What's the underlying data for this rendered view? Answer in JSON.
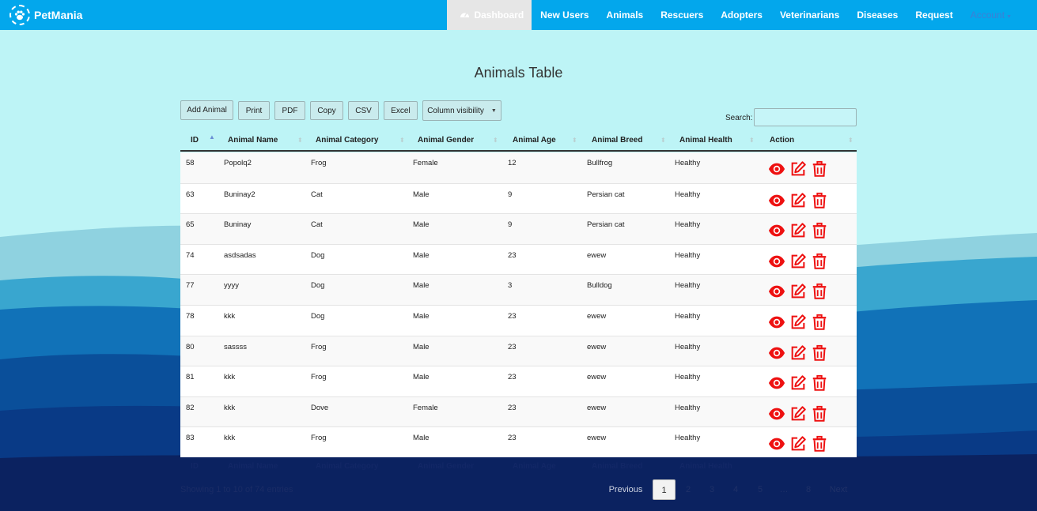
{
  "navbar": {
    "brand": "PetMania",
    "items": [
      {
        "label": "Dashboard"
      },
      {
        "label": "New Users"
      },
      {
        "label": "Animals"
      },
      {
        "label": "Rescuers"
      },
      {
        "label": "Adopters"
      },
      {
        "label": "Veterinarians"
      },
      {
        "label": "Diseases"
      },
      {
        "label": "Request"
      },
      {
        "label": "Account"
      }
    ]
  },
  "page": {
    "title": "Animals Table"
  },
  "toolbar": {
    "add": "Add Animal",
    "print": "Print",
    "pdf": "PDF",
    "copy": "Copy",
    "csv": "CSV",
    "excel": "Excel",
    "colvis": "Column visibility",
    "search_label": "Search:",
    "search_value": ""
  },
  "table": {
    "columns": [
      "ID",
      "Animal Name",
      "Animal Category",
      "Animal Gender",
      "Animal Age",
      "Animal Breed",
      "Animal Health",
      "Action"
    ],
    "rows": [
      [
        "58",
        "Popolq2",
        "Frog",
        "Female",
        "12",
        "Bullfrog",
        "Healthy"
      ],
      [
        "63",
        "Buninay2",
        "Cat",
        "Male",
        "9",
        "Persian cat",
        "Healthy"
      ],
      [
        "65",
        "Buninay",
        "Cat",
        "Male",
        "9",
        "Persian cat",
        "Healthy"
      ],
      [
        "74",
        "asdsadas",
        "Dog",
        "Male",
        "23",
        "ewew",
        "Healthy"
      ],
      [
        "77",
        "yyyy",
        "Dog",
        "Male",
        "3",
        "Bulldog",
        "Healthy"
      ],
      [
        "78",
        "kkk",
        "Dog",
        "Male",
        "23",
        "ewew",
        "Healthy"
      ],
      [
        "80",
        "sassss",
        "Frog",
        "Male",
        "23",
        "ewew",
        "Healthy"
      ],
      [
        "81",
        "kkk",
        "Frog",
        "Male",
        "23",
        "ewew",
        "Healthy"
      ],
      [
        "82",
        "kkk",
        "Dove",
        "Female",
        "23",
        "ewew",
        "Healthy"
      ],
      [
        "83",
        "kkk",
        "Frog",
        "Male",
        "23",
        "ewew",
        "Healthy"
      ]
    ],
    "footer": [
      "ID",
      "Animal Name",
      "Animal Category",
      "Animal Gender",
      "Animal Age",
      "Animal Breed",
      "Animal Health"
    ],
    "info": "Showing 1 to 10 of 74 entries",
    "action_icons": [
      "eye-icon",
      "edit-icon",
      "trash-icon"
    ],
    "action_color": "#ee1111"
  },
  "pagination": {
    "prev": "Previous",
    "pages": [
      "1",
      "2",
      "3",
      "4",
      "5",
      "…",
      "8"
    ],
    "current": "1",
    "next": "Next"
  },
  "colors": {
    "navbar": "#03a7ec",
    "sky": "#bdf4f6",
    "deep_sea": "#0b2260"
  }
}
